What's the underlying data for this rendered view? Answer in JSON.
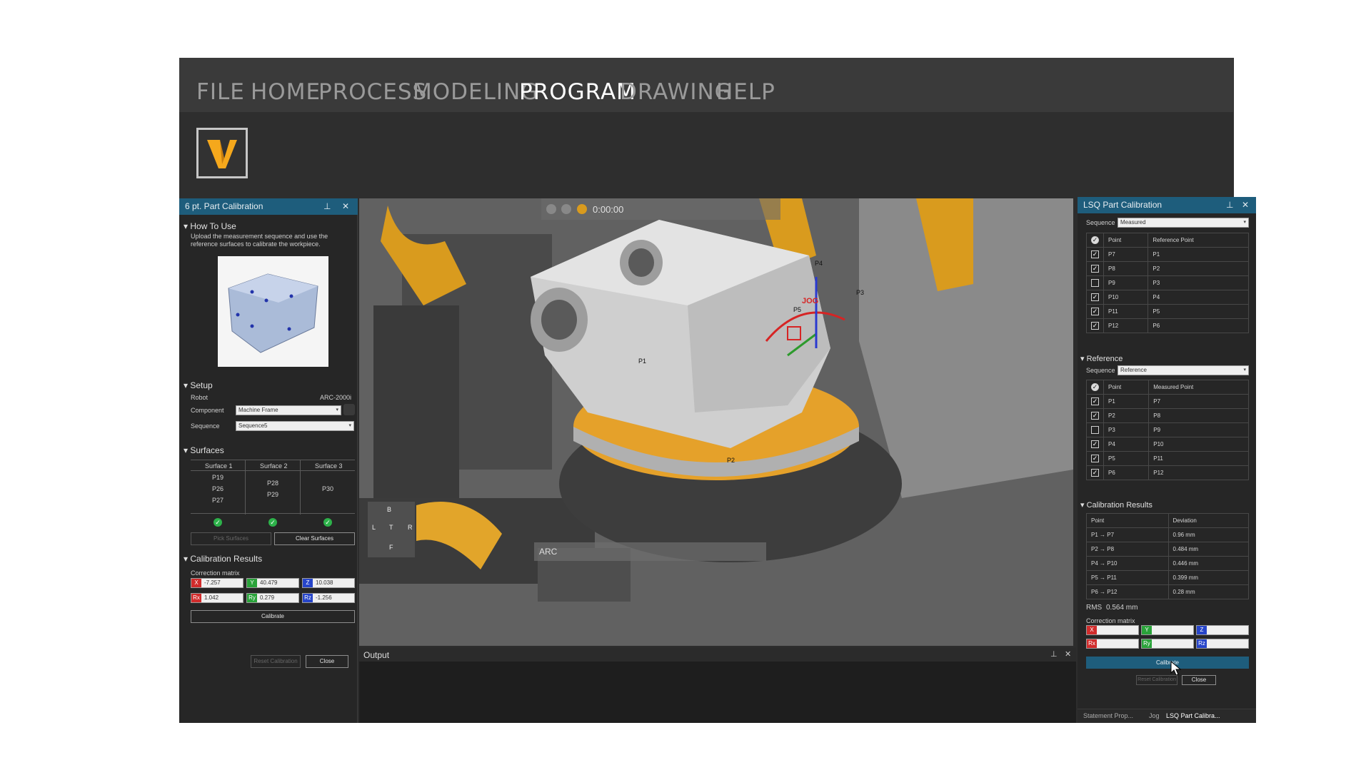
{
  "menu": [
    "FILE",
    "HOME",
    "PROCESS",
    "MODELING",
    "PROGRAM",
    "DRAWING",
    "HELP"
  ],
  "left_panel": {
    "title": "6 pt. Part Calibration",
    "how_to_use": "How To Use",
    "instructions": "Upload the measurement sequence and use the reference surfaces to calibrate the workpiece.",
    "setup": "Setup",
    "robot_label": "Robot",
    "robot_value": "ARC-2000i",
    "component_label": "Component",
    "component_value": "Machine Frame",
    "sequence_label": "Sequence",
    "sequence_value": "Sequence5",
    "surfaces": "Surfaces",
    "surface_headers": [
      "Surface 1",
      "Surface 2",
      "Surface 3"
    ],
    "surface1_points": [
      "P19",
      "P26",
      "P27"
    ],
    "surface2_points": [
      "P28",
      "P29"
    ],
    "surface3_points": [
      "P30"
    ],
    "pick_surfaces": "Pick Surfaces",
    "clear_surfaces": "Clear Surfaces",
    "calibration_results": "Calibration Results",
    "correction_matrix": "Correction matrix",
    "x": "-7.257",
    "y": "40.479",
    "z": "10.038",
    "rx": "1.042",
    "ry": "0.279",
    "rz": "-1.256",
    "calibrate": "Calibrate",
    "reset_calibration": "Reset Calibration",
    "close": "Close"
  },
  "viewport": {
    "time": "0:00:00",
    "view_labels": [
      "B",
      "L",
      "T",
      "R",
      "F"
    ],
    "points": [
      "P1",
      "P2",
      "P3",
      "P4",
      "P5"
    ],
    "jog": "JOG",
    "arc": "ARC"
  },
  "output": {
    "title": "Output"
  },
  "right_panel": {
    "title": "LSQ Part Calibration",
    "sequence_label": "Sequence",
    "sequence_value": "Measured",
    "measured_headers": [
      "Point",
      "Reference Point"
    ],
    "measured_rows": [
      {
        "checked": true,
        "point": "P7",
        "ref": "P1"
      },
      {
        "checked": true,
        "point": "P8",
        "ref": "P2"
      },
      {
        "checked": false,
        "point": "P9",
        "ref": "P3"
      },
      {
        "checked": true,
        "point": "P10",
        "ref": "P4"
      },
      {
        "checked": true,
        "point": "P11",
        "ref": "P5"
      },
      {
        "checked": true,
        "point": "P12",
        "ref": "P6"
      }
    ],
    "reference": "Reference",
    "ref_sequence_value": "Reference",
    "reference_headers": [
      "Point",
      "Measured Point"
    ],
    "reference_rows": [
      {
        "checked": true,
        "point": "P1",
        "meas": "P7"
      },
      {
        "checked": true,
        "point": "P2",
        "meas": "P8"
      },
      {
        "checked": false,
        "point": "P3",
        "meas": "P9"
      },
      {
        "checked": true,
        "point": "P4",
        "meas": "P10"
      },
      {
        "checked": true,
        "point": "P5",
        "meas": "P11"
      },
      {
        "checked": true,
        "point": "P6",
        "meas": "P12"
      }
    ],
    "calibration_results": "Calibration Results",
    "results_headers": [
      "Point",
      "Deviation"
    ],
    "results_rows": [
      {
        "point": "P1 → P7",
        "dev": "0.96 mm"
      },
      {
        "point": "P2 → P8",
        "dev": "0.484 mm"
      },
      {
        "point": "P4 → P10",
        "dev": "0.446 mm"
      },
      {
        "point": "P5 → P11",
        "dev": "0.399 mm"
      },
      {
        "point": "P6 → P12",
        "dev": "0.28 mm"
      }
    ],
    "rms_label": "RMS",
    "rms_value": "0.564 mm",
    "correction_matrix": "Correction matrix",
    "calibrate": "Calibrate",
    "reset_calibration": "Reset Calibration",
    "close": "Close",
    "tabs": [
      "Statement Prop...",
      "Jog",
      "LSQ Part Calibra..."
    ]
  }
}
